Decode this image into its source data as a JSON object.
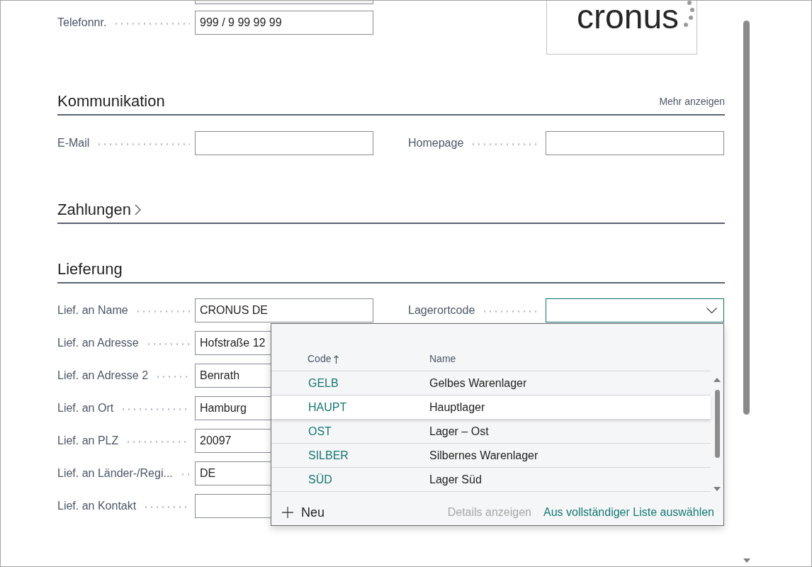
{
  "logo": {
    "text": "cronus"
  },
  "header_fields": [
    {
      "label": "Telefonnr.",
      "kind": "text",
      "value": "999 / 9 99 99 99"
    }
  ],
  "sections": [
    {
      "title": "Kommunikation",
      "expanded": true,
      "action": "Mehr anzeigen",
      "left_fields": [
        {
          "label": "E-Mail",
          "kind": "text"
        }
      ],
      "right_fields": [
        {
          "label": "Homepage",
          "kind": "text"
        }
      ]
    },
    {
      "title": "Zahlungen",
      "expanded": false
    },
    {
      "title": "Lieferung",
      "expanded": true,
      "left_fields": [
        {
          "label": "Lief. an Name",
          "kind": "text",
          "value": "CRONUS DE"
        },
        {
          "label": "Lief. an Adresse",
          "kind": "text",
          "value": "Hofstraße 12"
        },
        {
          "label": "Lief. an Adresse 2",
          "kind": "text",
          "value": "Benrath"
        },
        {
          "label": "Lief. an Ort",
          "kind": "text",
          "value": "Hamburg"
        },
        {
          "label": "Lief. an PLZ",
          "kind": "text",
          "value": "20097"
        },
        {
          "label": "Lief. an Länder-/Regi...",
          "kind": "text",
          "value": "DE"
        },
        {
          "label": "Lief. an Kontakt",
          "kind": "text"
        }
      ],
      "right_fields": [
        {
          "label": "Lagerortcode",
          "kind": "dropdown",
          "focused": true,
          "lookup": {
            "columns": [
              {
                "label": "Code",
                "sorted": true
              },
              {
                "label": "Name",
                "sorted": false
              }
            ],
            "rows": [
              {
                "code": "GELB",
                "name": "Gelbes Warenlager",
                "selected": false
              },
              {
                "code": "HAUPT",
                "name": "Hauptlager",
                "selected": true
              },
              {
                "code": "OST",
                "name": "Lager – Ost",
                "selected": false
              },
              {
                "code": "SILBER",
                "name": "Silbernes Warenlager",
                "selected": false
              },
              {
                "code": "SÜD",
                "name": "Lager Süd",
                "selected": false
              }
            ],
            "new_action": "Neu",
            "details_action": {
              "label": "Details anzeigen",
              "disabled": true
            },
            "full_list_action": {
              "label": "Aus vollständiger Liste auswählen",
              "disabled": false
            }
          }
        }
      ]
    }
  ]
}
